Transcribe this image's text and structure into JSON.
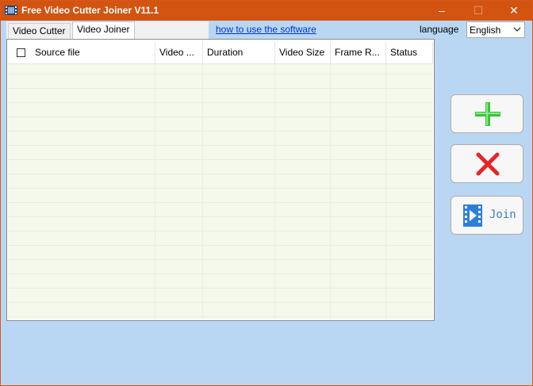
{
  "window": {
    "title": "Free Video Cutter Joiner V11.1"
  },
  "window_controls": {
    "minimize": "–",
    "maximize": "☐",
    "close": "✕"
  },
  "tabs": [
    {
      "label": "Video Cutter",
      "selected": false
    },
    {
      "label": "Video Joiner",
      "selected": true
    }
  ],
  "help_link": "how to use the software",
  "language": {
    "label": "language",
    "selected": "English"
  },
  "table": {
    "columns": [
      "Source file",
      "Video ...",
      "Duration",
      "Video Size",
      "Frame R...",
      "Status"
    ],
    "rows": []
  },
  "buttons": {
    "join_label": "Join"
  },
  "icons": {
    "add": "plus-icon",
    "delete": "x-icon",
    "join": "film-play-icon",
    "app": "film-app-icon"
  },
  "colors": {
    "titlebar": "#d35410",
    "background": "#b9d7f3",
    "list_background": "#f4f9ec",
    "add_icon": "#3cc43c",
    "delete_icon": "#e62525",
    "join_icon": "#2d7fd6",
    "link": "#0033cc"
  }
}
